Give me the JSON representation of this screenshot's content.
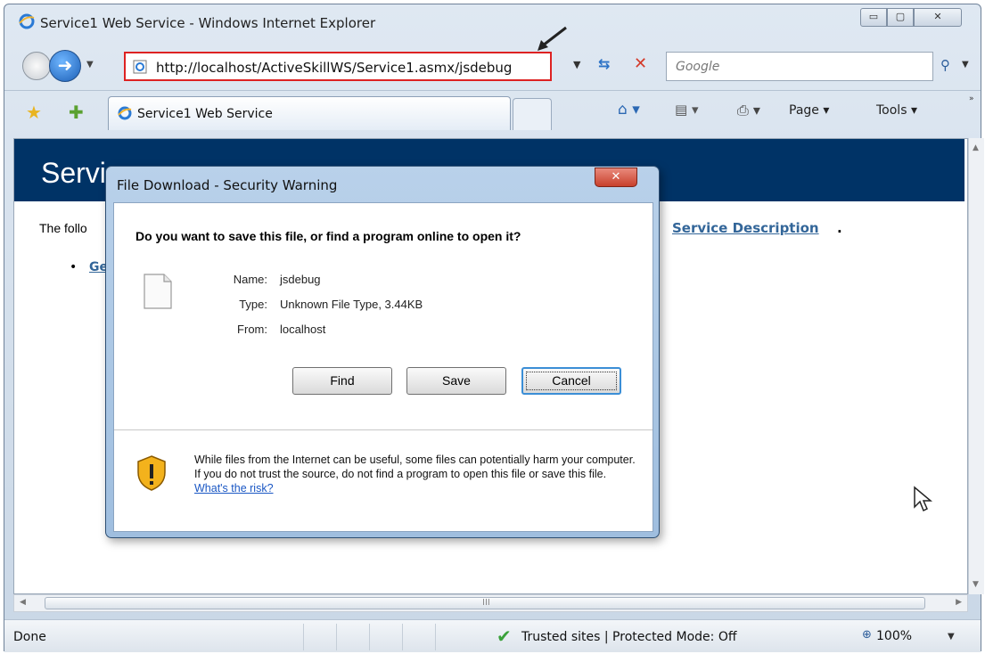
{
  "window": {
    "title": "Service1 Web Service - Windows Internet Explorer",
    "min_glyph": "▭",
    "max_glyph": "▢",
    "close_glyph": "✕"
  },
  "nav": {
    "url": "http://localhost/ActiveSkillWS/Service1.asmx/jsdebug",
    "search_placeholder": "Google",
    "forward_glyph": "➜",
    "drop_glyph": "▼",
    "refresh_glyph": "⇆",
    "stop_glyph": "✕",
    "search_glyph": "⚲"
  },
  "favorites": {
    "tab_label": "Service1 Web Service",
    "star_glyph": "★",
    "add_glyph": "✚"
  },
  "commands": {
    "home_glyph": "⌂ ▾",
    "feed_glyph": "▤ ▾",
    "print_glyph": "⎙ ▾",
    "page": "Page ▾",
    "tools": "Tools ▾",
    "chevron": "»"
  },
  "page": {
    "header_title": "Servi",
    "intro_text": "The follo",
    "service_description_link": "Service Description",
    "service_description_end": ".",
    "bullet": "•",
    "operation_link_partial": "Ge"
  },
  "dialog": {
    "title": "File Download - Security Warning",
    "close_glyph": "✕",
    "question": "Do you want to save this file, or find a program online to open it?",
    "name_label": "Name:",
    "name_value": "jsdebug",
    "type_label": "Type:",
    "type_value": "Unknown File Type, 3.44KB",
    "from_label": "From:",
    "from_value": "localhost",
    "find_button": "Find",
    "save_button": "Save",
    "cancel_button": "Cancel",
    "warning_text": "While files from the Internet can be useful, some files can potentially harm your computer. If you do not trust the source, do not find a program to open this file or save this file. ",
    "risk_link": "What's the risk?"
  },
  "status": {
    "text": "Done",
    "zone": "Trusted sites | Protected Mode: Off",
    "zoom": "100%",
    "check_glyph": "✔",
    "zoom_glyph": "⊕",
    "drop_glyph": "▼"
  },
  "scroll": {
    "up": "▲",
    "down": "▼",
    "left": "◀",
    "right": "▶",
    "grip": "III"
  },
  "colors": {
    "page_header": "#003366",
    "link": "#336699",
    "address_highlight": "#dd2222",
    "dialog_frame": "#9fbedf"
  }
}
